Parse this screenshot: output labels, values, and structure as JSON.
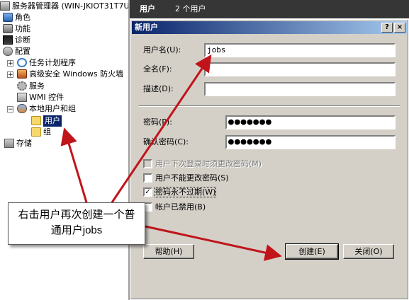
{
  "tree": {
    "header": "服务器管理器 (WIN-JKIOT31T7U",
    "items": [
      {
        "label": "角色"
      },
      {
        "label": "功能"
      },
      {
        "label": "诊断"
      },
      {
        "label": "配置"
      },
      {
        "label": "任务计划程序"
      },
      {
        "label": "高级安全 Windows 防火墙"
      },
      {
        "label": "服务"
      },
      {
        "label": "WMI 控件"
      },
      {
        "label": "本地用户和组"
      },
      {
        "label": "用户"
      },
      {
        "label": "组"
      },
      {
        "label": "存储"
      }
    ]
  },
  "right_header": {
    "title": "用户",
    "count": "2 个用户"
  },
  "dialog": {
    "title": "新用户",
    "help_glyph": "?",
    "close_glyph": "×",
    "username_label": "用户名(U):",
    "username_value": "jobs",
    "fullname_label": "全名(F):",
    "fullname_value": "",
    "description_label": "描述(D):",
    "description_value": "",
    "password_label": "密码(P):",
    "password_value": "●●●●●●●",
    "confirm_label": "确认密码(C):",
    "confirm_value": "●●●●●●●",
    "checkboxes": [
      {
        "label": "用户下次登录时须更改密码(M)",
        "checked": false,
        "enabled": false
      },
      {
        "label": "用户不能更改密码(S)",
        "checked": false,
        "enabled": true
      },
      {
        "label": "密码永不过期(W)",
        "checked": true,
        "enabled": true
      },
      {
        "label": "帐户已禁用(B)",
        "checked": false,
        "enabled": true
      }
    ],
    "check_glyph": "✓",
    "help_button": "帮助(H)",
    "create_button": "创建(E)",
    "close_button": "关闭(O)"
  },
  "callout": {
    "line1": "右击用户再次创建一个普",
    "line2": "通用户jobs"
  },
  "colors": {
    "selection": "#0a246a",
    "arrow": "#c0141a",
    "dialog_bg": "#d4d0c8",
    "header_bg": "#363636"
  }
}
